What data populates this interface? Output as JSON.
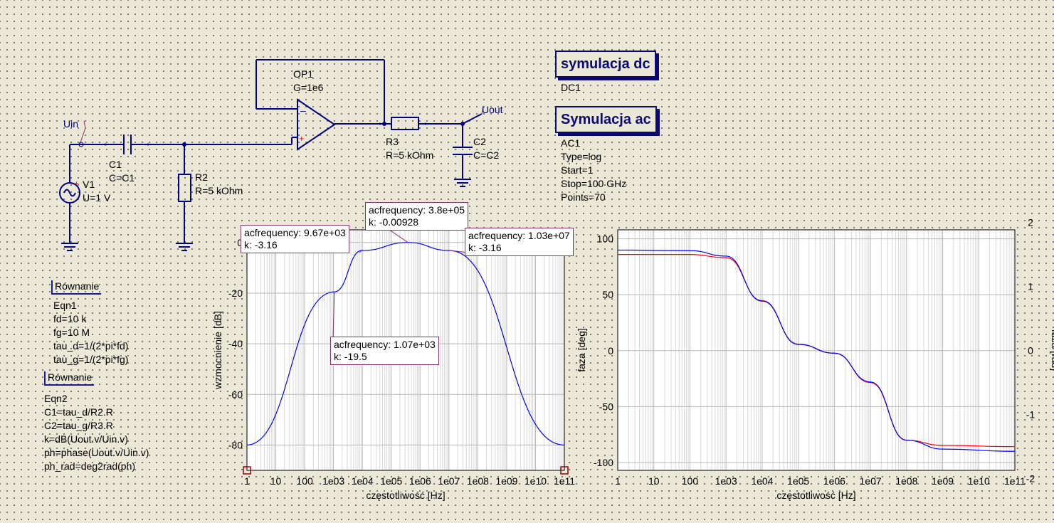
{
  "schematic": {
    "opamp": {
      "name": "OP1",
      "param": "G=1e6"
    },
    "source": {
      "name": "V1",
      "param": "U=1 V"
    },
    "c1": {
      "name": "C1",
      "param": "C=C1"
    },
    "r2": {
      "name": "R2",
      "param": "R=5 kOhm"
    },
    "r3": {
      "name": "R3",
      "param": "R=5 kOhm"
    },
    "c2": {
      "name": "C2",
      "param": "C=C2"
    },
    "label_uin": "Uin",
    "label_uout": "Uout"
  },
  "sim_dc": {
    "title": "symulacja dc",
    "name": "DC1"
  },
  "sim_ac": {
    "title": "Symulacja ac",
    "name": "AC1",
    "lines": [
      "Type=log",
      "Start=1",
      "Stop=100 GHz",
      "Points=70"
    ]
  },
  "eqn1": {
    "title": "Równanie",
    "name": "Eqn1",
    "lines": [
      "fd=10 k",
      "fg=10 M",
      "tau_d=1/(2*pi*fd)",
      "tau_g=1/(2*pi*fg)"
    ]
  },
  "eqn2": {
    "title": "Równanie",
    "name": "Eqn2",
    "lines": [
      "C1=tau_d/R2.R",
      "C2=tau_g/R3.R",
      "k=dB(Uout.v/Uin.v)",
      "ph=phase(Uout.v/Uin.v)",
      "ph_rad=deg2rad(ph)"
    ]
  },
  "markers": [
    {
      "line1": "acfrequency: 9.67e+03",
      "line2": "k: -3.16"
    },
    {
      "line1": "acfrequency: 3.8e+05",
      "line2": "k: -0.00928"
    },
    {
      "line1": "acfrequency: 1.03e+07",
      "line2": "k: -3.16"
    },
    {
      "line1": "acfrequency: 1.07e+03",
      "line2": "k: -19.5"
    }
  ],
  "chart_data": [
    {
      "type": "line",
      "title": "",
      "xlabel": "częstotliwość [Hz]",
      "ylabel": "wzmocnienie [dB]",
      "xscale": "log",
      "xlim": [
        1,
        100000000000
      ],
      "ylim": [
        -90,
        5
      ],
      "x_ticks": [
        "1",
        "10",
        "100",
        "1e03",
        "1e04",
        "1e05",
        "1e06",
        "1e07",
        "1e08",
        "1e09",
        "1e10",
        "1e11"
      ],
      "y_ticks": [
        0,
        -20,
        -40,
        -60,
        -80
      ],
      "grid": true,
      "series": [
        {
          "color": "#0000ff",
          "x": [
            1,
            1070,
            9670,
            380000,
            10300000,
            100000000000
          ],
          "y": [
            -79.97,
            -19.5,
            -3.16,
            -0.00928,
            -3.16,
            -80.0
          ]
        }
      ]
    },
    {
      "type": "line",
      "title": "",
      "xlabel": "częstotliwość [Hz]",
      "ylabel": "faza [deg]",
      "y2label": "faza [rad]",
      "xscale": "log",
      "xlim": [
        1,
        100000000000
      ],
      "ylim": [
        -107,
        108
      ],
      "y2lim": [
        -1.87,
        1.885
      ],
      "x_ticks": [
        "1",
        "10",
        "100",
        "1e03",
        "1e04",
        "1e05",
        "1e06",
        "1e07",
        "1e08",
        "1e09",
        "1e10",
        "1e11"
      ],
      "y_ticks": [
        100,
        50,
        0,
        -50,
        -100
      ],
      "y2_ticks": [
        2,
        1,
        0,
        -1,
        -2
      ],
      "grid": true,
      "series": [
        {
          "color": "#ff0000",
          "axis": "right",
          "x": [
            1,
            100,
            1000,
            10000,
            100000,
            1000000,
            10000000,
            100000000,
            1000000000,
            100000000000
          ],
          "y": [
            1.5,
            1.5,
            1.45,
            0.78,
            0.1,
            -0.04,
            -0.5,
            -1.4,
            -1.48,
            -1.5
          ]
        },
        {
          "color": "#0000ff",
          "axis": "left",
          "x": [
            1,
            100,
            1000,
            10000,
            100000,
            1000000,
            10000000,
            100000000,
            1000000000,
            100000000000
          ],
          "y": [
            89.9,
            89.4,
            84.5,
            44.3,
            5.6,
            -2.3,
            -28.0,
            -80.0,
            -88.0,
            -90.0
          ]
        }
      ]
    }
  ]
}
